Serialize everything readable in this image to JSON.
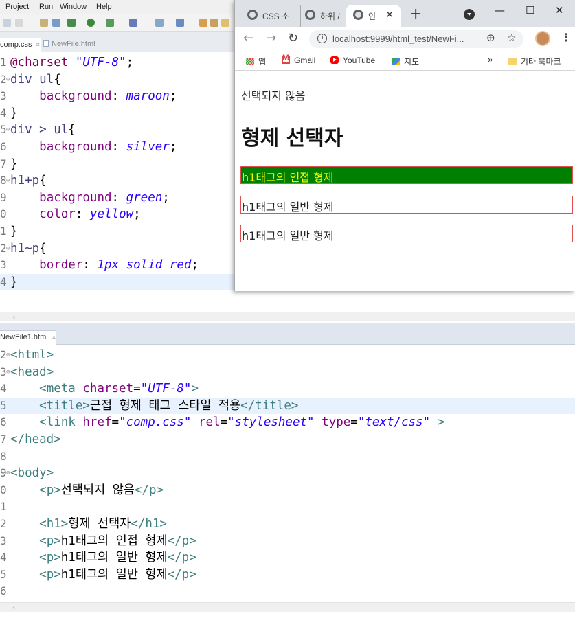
{
  "ide": {
    "menu": [
      "Project",
      "Run",
      "Window",
      "Help"
    ],
    "top_tabs": [
      {
        "label": "comp.css",
        "active": true
      },
      {
        "label": "NewFile.html",
        "active": false
      }
    ],
    "bottom_tab": {
      "label": "NewFile1.html"
    },
    "css_lines": [
      {
        "n": "1",
        "segs": [
          [
            "c-at",
            "@charset "
          ],
          [
            "c-str",
            "\"UTF-8\""
          ],
          [
            "c-plain",
            ";"
          ]
        ]
      },
      {
        "n": "2",
        "fold": true,
        "segs": [
          [
            "c-sel",
            "div ul"
          ],
          [
            "c-plain",
            "{"
          ]
        ]
      },
      {
        "n": "3",
        "segs": [
          [
            "c-plain",
            "    "
          ],
          [
            "c-prop",
            "background"
          ],
          [
            "c-plain",
            ": "
          ],
          [
            "c-val",
            "maroon"
          ],
          [
            "c-plain",
            ";"
          ]
        ]
      },
      {
        "n": "4",
        "segs": [
          [
            "c-plain",
            "}"
          ]
        ]
      },
      {
        "n": "5",
        "fold": true,
        "segs": [
          [
            "c-sel",
            "div > ul"
          ],
          [
            "c-plain",
            "{"
          ]
        ]
      },
      {
        "n": "6",
        "segs": [
          [
            "c-plain",
            "    "
          ],
          [
            "c-prop",
            "background"
          ],
          [
            "c-plain",
            ": "
          ],
          [
            "c-val",
            "silver"
          ],
          [
            "c-plain",
            ";"
          ]
        ]
      },
      {
        "n": "7",
        "segs": [
          [
            "c-plain",
            "}"
          ]
        ]
      },
      {
        "n": "8",
        "fold": true,
        "segs": [
          [
            "c-sel",
            "h1+p"
          ],
          [
            "c-plain",
            "{"
          ]
        ]
      },
      {
        "n": "9",
        "segs": [
          [
            "c-plain",
            "    "
          ],
          [
            "c-prop",
            "background"
          ],
          [
            "c-plain",
            ": "
          ],
          [
            "c-val",
            "green"
          ],
          [
            "c-plain",
            ";"
          ]
        ]
      },
      {
        "n": "0",
        "segs": [
          [
            "c-plain",
            "    "
          ],
          [
            "c-prop",
            "color"
          ],
          [
            "c-plain",
            ": "
          ],
          [
            "c-val",
            "yellow"
          ],
          [
            "c-plain",
            ";"
          ]
        ]
      },
      {
        "n": "1",
        "segs": [
          [
            "c-plain",
            "}"
          ]
        ]
      },
      {
        "n": "2",
        "fold": true,
        "segs": [
          [
            "c-sel",
            "h1~p"
          ],
          [
            "c-plain",
            "{"
          ]
        ]
      },
      {
        "n": "3",
        "segs": [
          [
            "c-plain",
            "    "
          ],
          [
            "c-prop",
            "border"
          ],
          [
            "c-plain",
            ": "
          ],
          [
            "c-val",
            "1px solid red"
          ],
          [
            "c-plain",
            ";"
          ]
        ]
      },
      {
        "n": "4",
        "hl": true,
        "segs": [
          [
            "c-plain",
            "}"
          ]
        ]
      }
    ],
    "html_lines": [
      {
        "n": "2",
        "fold": true,
        "segs": [
          [
            "c-tag",
            "<html>"
          ]
        ]
      },
      {
        "n": "3",
        "fold": true,
        "segs": [
          [
            "c-tag",
            "<head>"
          ]
        ]
      },
      {
        "n": "4",
        "segs": [
          [
            "c-plain",
            "    "
          ],
          [
            "c-tag",
            "<meta "
          ],
          [
            "c-attr",
            "charset"
          ],
          [
            "c-plain",
            "="
          ],
          [
            "c-str",
            "\"UTF-8\""
          ],
          [
            "c-tag",
            ">"
          ]
        ]
      },
      {
        "n": "5",
        "hl": true,
        "segs": [
          [
            "c-plain",
            "    "
          ],
          [
            "c-tag",
            "<title>"
          ],
          [
            "c-txt",
            "근접 형제 태그 스타일 적용"
          ],
          [
            "c-tag",
            "</title>"
          ]
        ]
      },
      {
        "n": "6",
        "segs": [
          [
            "c-plain",
            "    "
          ],
          [
            "c-tag",
            "<link "
          ],
          [
            "c-attr",
            "href"
          ],
          [
            "c-plain",
            "="
          ],
          [
            "c-str",
            "\"comp.css\""
          ],
          [
            "c-plain",
            " "
          ],
          [
            "c-attr",
            "rel"
          ],
          [
            "c-plain",
            "="
          ],
          [
            "c-str",
            "\"stylesheet\""
          ],
          [
            "c-plain",
            " "
          ],
          [
            "c-attr",
            "type"
          ],
          [
            "c-plain",
            "="
          ],
          [
            "c-str",
            "\"text/css\""
          ],
          [
            "c-plain",
            " "
          ],
          [
            "c-tag",
            ">"
          ]
        ]
      },
      {
        "n": "7",
        "segs": [
          [
            "c-tag",
            "</head>"
          ]
        ]
      },
      {
        "n": "8",
        "segs": []
      },
      {
        "n": "9",
        "fold": true,
        "segs": [
          [
            "c-tag",
            "<body>"
          ]
        ]
      },
      {
        "n": "0",
        "segs": [
          [
            "c-plain",
            "    "
          ],
          [
            "c-tag",
            "<p>"
          ],
          [
            "c-txt",
            "선택되지 않음"
          ],
          [
            "c-tag",
            "</p>"
          ]
        ]
      },
      {
        "n": "1",
        "segs": []
      },
      {
        "n": "2",
        "segs": [
          [
            "c-plain",
            "    "
          ],
          [
            "c-tag",
            "<h1>"
          ],
          [
            "c-txt",
            "형제 선택자"
          ],
          [
            "c-tag",
            "</h1>"
          ]
        ]
      },
      {
        "n": "3",
        "segs": [
          [
            "c-plain",
            "    "
          ],
          [
            "c-tag",
            "<p>"
          ],
          [
            "c-txt",
            "h1태그의 인접 형제"
          ],
          [
            "c-tag",
            "</p>"
          ]
        ]
      },
      {
        "n": "4",
        "segs": [
          [
            "c-plain",
            "    "
          ],
          [
            "c-tag",
            "<p>"
          ],
          [
            "c-txt",
            "h1태그의 일반 형제"
          ],
          [
            "c-tag",
            "</p>"
          ]
        ]
      },
      {
        "n": "5",
        "segs": [
          [
            "c-plain",
            "    "
          ],
          [
            "c-tag",
            "<p>"
          ],
          [
            "c-txt",
            "h1태그의 일반 형제"
          ],
          [
            "c-tag",
            "</p>"
          ]
        ]
      },
      {
        "n": "6",
        "segs": []
      }
    ]
  },
  "browser": {
    "tabs": [
      {
        "label": "CSS 소",
        "active": false
      },
      {
        "label": "하위 /",
        "active": false
      },
      {
        "label": "인",
        "active": true
      }
    ],
    "new_tab_icon": "plus-icon",
    "window_controls": {
      "minimize": "—",
      "maximize": "☐",
      "close": "✕"
    },
    "url": "localhost:9999/html_test/NewFi...",
    "bookmarks": [
      {
        "label": "앱",
        "icon": "apps-icon"
      },
      {
        "label": "Gmail",
        "icon": "gmail-icon"
      },
      {
        "label": "YouTube",
        "icon": "youtube-icon"
      },
      {
        "label": "지도",
        "icon": "maps-icon"
      }
    ],
    "bookmarks_more": "»",
    "other_bookmarks": "기타 북마크",
    "page": {
      "p_plain": "선택되지 않음",
      "h1": "형제 선택자",
      "p_adjacent": "h1태그의 인접 형제",
      "p_general_1": "h1태그의 일반 형제",
      "p_general_2": "h1태그의 일반 형제"
    },
    "colors": {
      "adjacent_bg": "#008000",
      "adjacent_fg": "#ffff00",
      "border": "#ff0000"
    }
  }
}
